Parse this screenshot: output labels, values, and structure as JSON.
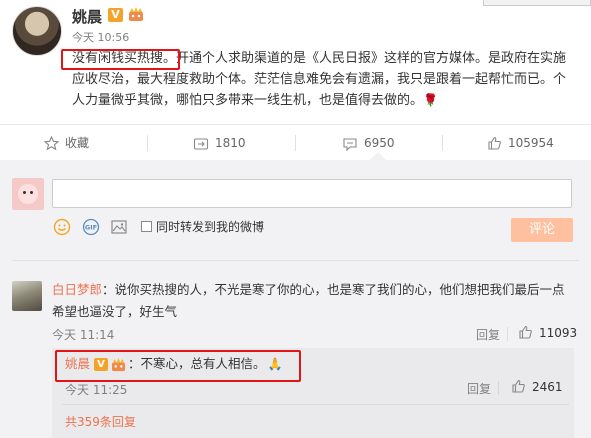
{
  "post": {
    "author": "姚晨",
    "verified_badge": "V",
    "time": "今天 10:56",
    "text_highlight": "没有闲钱买热搜。",
    "text_rest": "开通个人求助渠道的是《人民日报》这样的官方媒体。是政府在实施应收尽治，最大程度救助个体。茫茫信息难免会有遗漏，我只是跟着一起帮忙而已。个人力量微乎其微，哪怕只多带来一线生机，也是值得去做的。",
    "emoji": "🌹"
  },
  "actions": {
    "favorite_label": "收藏",
    "repost_count": "1810",
    "comment_count": "6950",
    "like_count": "105954"
  },
  "composer": {
    "repost_label": "同时转发到我的微博",
    "submit_label": "评论"
  },
  "comment": {
    "user": "白日梦郎",
    "text": "：说你买热搜的人，不光是寒了你的心，也是寒了我们的心，他们想把我们最后一点希望也逼没了，好生气",
    "time": "今天 11:14",
    "reply_label": "回复",
    "like_count": "11093"
  },
  "reply": {
    "user": "姚晨",
    "verified_badge": "V",
    "text": "：不寒心，总有人相信。",
    "emoji": "🙏",
    "time": "今天 11:25",
    "reply_label": "回复",
    "like_count": "2461",
    "more_replies": "共359条回复"
  },
  "colors": {
    "accent_orange": "#eb7350",
    "highlight_red": "#e01515",
    "verified_gold": "#f3a32a",
    "button_disabled": "#ffc09f"
  }
}
